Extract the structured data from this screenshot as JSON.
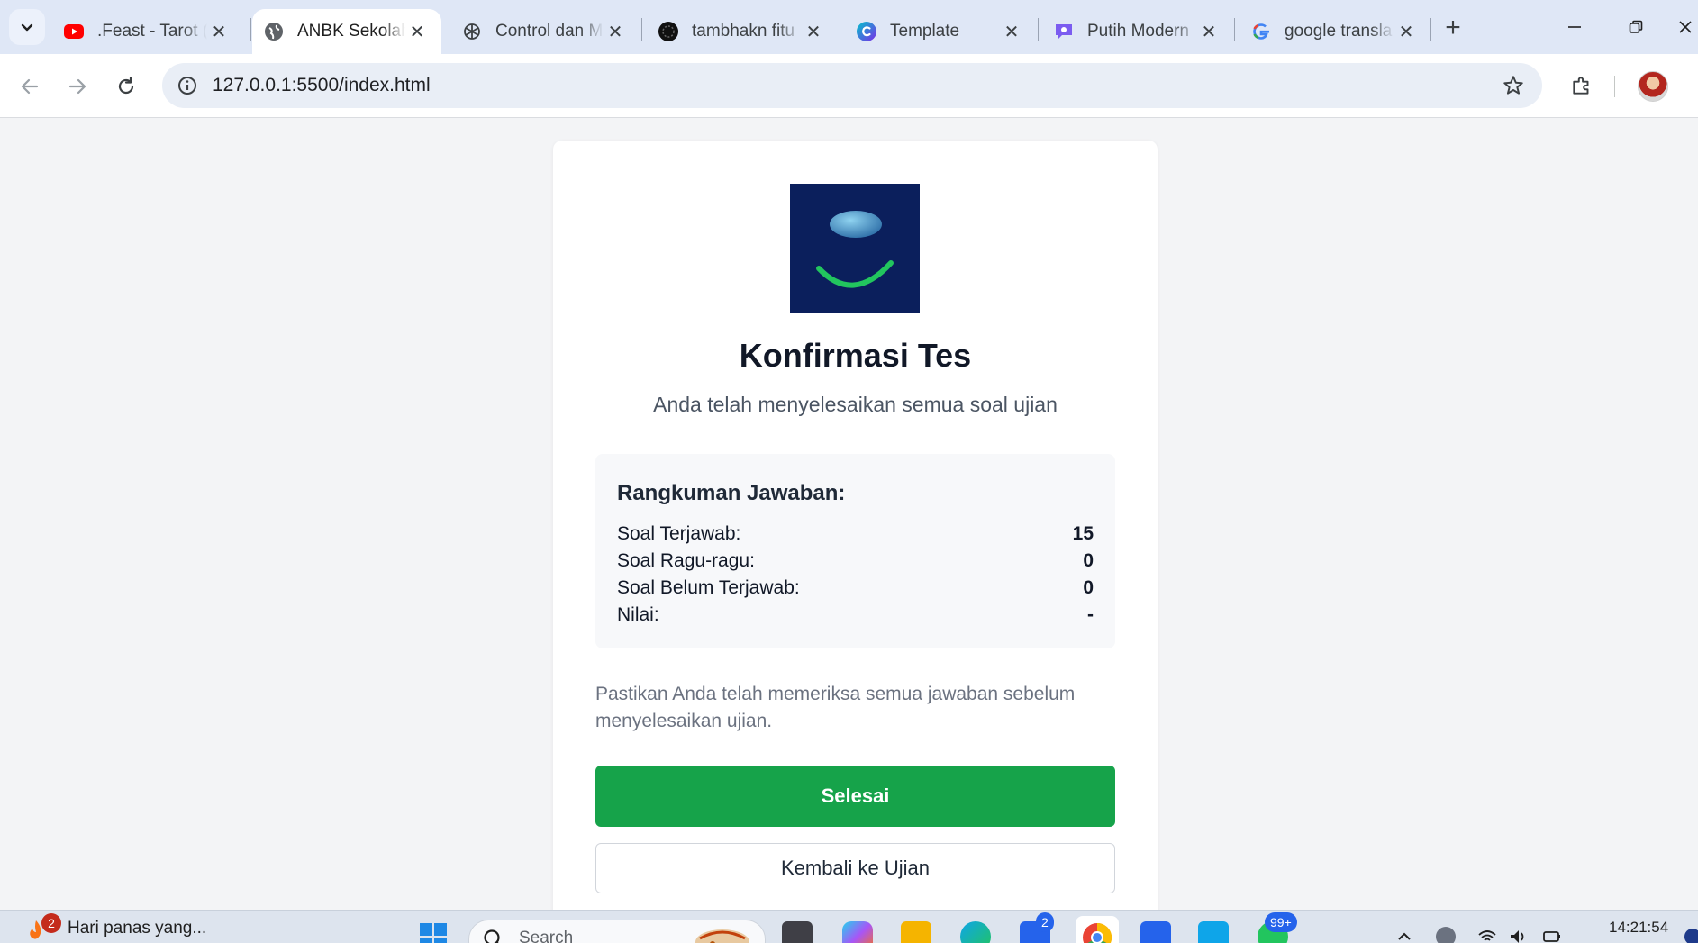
{
  "browser": {
    "tabs": [
      {
        "title": ".Feast - Tarot (",
        "icon": "youtube-icon",
        "active": false
      },
      {
        "title": "ANBK Sekolah",
        "icon": "globe-icon",
        "active": true
      },
      {
        "title": "Control dan M",
        "icon": "openai-icon",
        "active": false
      },
      {
        "title": "tambhakn fitu",
        "icon": "dark-circle-icon",
        "active": false
      },
      {
        "title": "Template",
        "icon": "canva-icon",
        "active": false
      },
      {
        "title": "Putih Modern",
        "icon": "chat-bubble-icon",
        "active": false
      },
      {
        "title": "google transla",
        "icon": "google-icon",
        "active": false
      }
    ],
    "url": "127.0.0.1:5500/index.html"
  },
  "page": {
    "title": "Konfirmasi Tes",
    "subtitle": "Anda telah menyelesaikan semua soal ujian",
    "summary": {
      "title": "Rangkuman Jawaban:",
      "rows": [
        {
          "label": "Soal Terjawab:",
          "value": "15"
        },
        {
          "label": "Soal Ragu-ragu:",
          "value": "0"
        },
        {
          "label": "Soal Belum Terjawab:",
          "value": "0"
        },
        {
          "label": "Nilai:",
          "value": "-"
        }
      ]
    },
    "note": "Pastikan Anda telah memeriksa semua jawaban sebelum menyelesaikan ujian.",
    "finish_label": "Selesai",
    "back_label": "Kembali ke Ujian"
  },
  "taskbar": {
    "weather_text": "Hari panas yang...",
    "weather_badge": "2",
    "search_placeholder": "Search",
    "mail_badge": "2",
    "whatsapp_badge": "99+",
    "clock": "14:21:54"
  },
  "colors": {
    "finish_button": "#16a34a",
    "logo_background": "#0b1f5c",
    "logo_smile": "#22c55e"
  }
}
